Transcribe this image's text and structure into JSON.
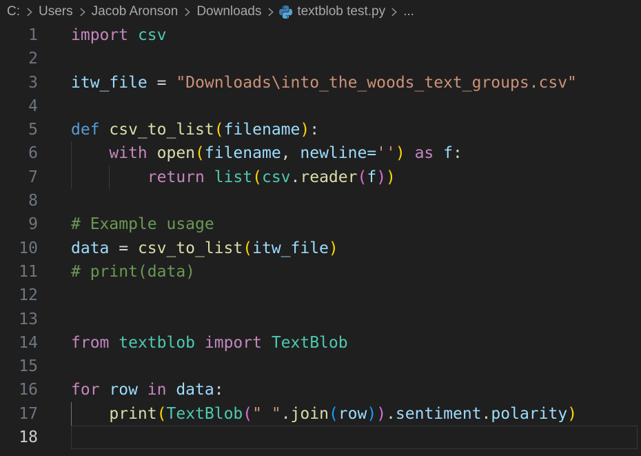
{
  "breadcrumb": {
    "items": [
      {
        "label": "C:"
      },
      {
        "label": "Users"
      },
      {
        "label": "Jacob Aronson"
      },
      {
        "label": "Downloads"
      },
      {
        "label": "textblob test.py",
        "icon": "python"
      },
      {
        "label": "..."
      }
    ]
  },
  "editor": {
    "language": "Python",
    "lines": [
      {
        "n": 1,
        "tokens": [
          [
            "import ",
            "kw"
          ],
          [
            "csv",
            "cls"
          ]
        ]
      },
      {
        "n": 2,
        "tokens": []
      },
      {
        "n": 3,
        "tokens": [
          [
            "itw_file",
            "var"
          ],
          [
            " = ",
            "pun"
          ],
          [
            "\"Downloads\\into_the_woods_text_groups.csv\"",
            "str"
          ]
        ]
      },
      {
        "n": 4,
        "tokens": []
      },
      {
        "n": 5,
        "tokens": [
          [
            "def ",
            "kwb"
          ],
          [
            "csv_to_list",
            "fn"
          ],
          [
            "(",
            "b1"
          ],
          [
            "filename",
            "var"
          ],
          [
            ")",
            "b1"
          ],
          [
            ":",
            "pun"
          ]
        ]
      },
      {
        "n": 6,
        "tokens": [
          [
            "    ",
            "pln"
          ],
          [
            "with ",
            "kw"
          ],
          [
            "open",
            "fn"
          ],
          [
            "(",
            "b1"
          ],
          [
            "filename",
            "var"
          ],
          [
            ", ",
            "pun"
          ],
          [
            "newline=",
            "var"
          ],
          [
            "''",
            "str"
          ],
          [
            ")",
            "b1"
          ],
          [
            " as ",
            "kw"
          ],
          [
            "f",
            "var"
          ],
          [
            ":",
            "pun"
          ]
        ],
        "guides": [
          0
        ]
      },
      {
        "n": 7,
        "tokens": [
          [
            "        ",
            "pln"
          ],
          [
            "return ",
            "kw"
          ],
          [
            "list",
            "cls"
          ],
          [
            "(",
            "b1"
          ],
          [
            "csv",
            "cls"
          ],
          [
            ".",
            "pun"
          ],
          [
            "reader",
            "fn"
          ],
          [
            "(",
            "b2"
          ],
          [
            "f",
            "var"
          ],
          [
            ")",
            "b2"
          ],
          [
            ")",
            "b1"
          ]
        ],
        "guides": [
          0,
          1
        ]
      },
      {
        "n": 8,
        "tokens": []
      },
      {
        "n": 9,
        "tokens": [
          [
            "# Example usage",
            "com"
          ]
        ]
      },
      {
        "n": 10,
        "tokens": [
          [
            "data",
            "var"
          ],
          [
            " = ",
            "pun"
          ],
          [
            "csv_to_list",
            "fn"
          ],
          [
            "(",
            "b1"
          ],
          [
            "itw_file",
            "var"
          ],
          [
            ")",
            "b1"
          ]
        ]
      },
      {
        "n": 11,
        "tokens": [
          [
            "# print(data)",
            "com"
          ]
        ]
      },
      {
        "n": 12,
        "tokens": []
      },
      {
        "n": 13,
        "tokens": []
      },
      {
        "n": 14,
        "tokens": [
          [
            "from ",
            "kw"
          ],
          [
            "textblob",
            "cls"
          ],
          [
            " import ",
            "kw"
          ],
          [
            "TextBlob",
            "cls"
          ]
        ]
      },
      {
        "n": 15,
        "tokens": []
      },
      {
        "n": 16,
        "tokens": [
          [
            "for ",
            "kw"
          ],
          [
            "row",
            "var"
          ],
          [
            " in ",
            "kw"
          ],
          [
            "data",
            "var"
          ],
          [
            ":",
            "pun"
          ]
        ]
      },
      {
        "n": 17,
        "tokens": [
          [
            "    ",
            "pln"
          ],
          [
            "print",
            "fn"
          ],
          [
            "(",
            "b1"
          ],
          [
            "TextBlob",
            "cls"
          ],
          [
            "(",
            "b2"
          ],
          [
            "\" \"",
            "str"
          ],
          [
            ".",
            "pun"
          ],
          [
            "join",
            "fn"
          ],
          [
            "(",
            "b3"
          ],
          [
            "row",
            "var"
          ],
          [
            ")",
            "b3"
          ],
          [
            ")",
            "b2"
          ],
          [
            ".",
            "pun"
          ],
          [
            "sentiment",
            "var"
          ],
          [
            ".",
            "pun"
          ],
          [
            "polarity",
            "var"
          ],
          [
            ")",
            "b1"
          ]
        ],
        "active_guides": [
          0
        ]
      },
      {
        "n": 18,
        "tokens": [],
        "current": true
      }
    ]
  },
  "colors": {
    "editor_bg": "#1f1f1f",
    "breadcrumb_text": "#a8a8a8",
    "breadcrumb_chevron": "#9a9a9a",
    "line_number": "#6e7681",
    "line_number_active": "#cccccc",
    "indent_guide": "#3b3b3b",
    "indent_guide_active": "#767676",
    "current_line_border": "#373737",
    "python_icon_dark": "#3c79ab",
    "python_icon_light": "#57a6d8",
    "tokens": {
      "kw": "#C586C0",
      "kwb": "#569CD6",
      "fn": "#DCDCAA",
      "var": "#9CDCFE",
      "cls": "#4EC9B0",
      "str": "#CE9178",
      "com": "#6A9955",
      "pun": "#D4D4D4",
      "pln": "#D4D4D4",
      "b1": "#FFD700",
      "b2": "#DA70D6",
      "b3": "#179FFF"
    }
  }
}
